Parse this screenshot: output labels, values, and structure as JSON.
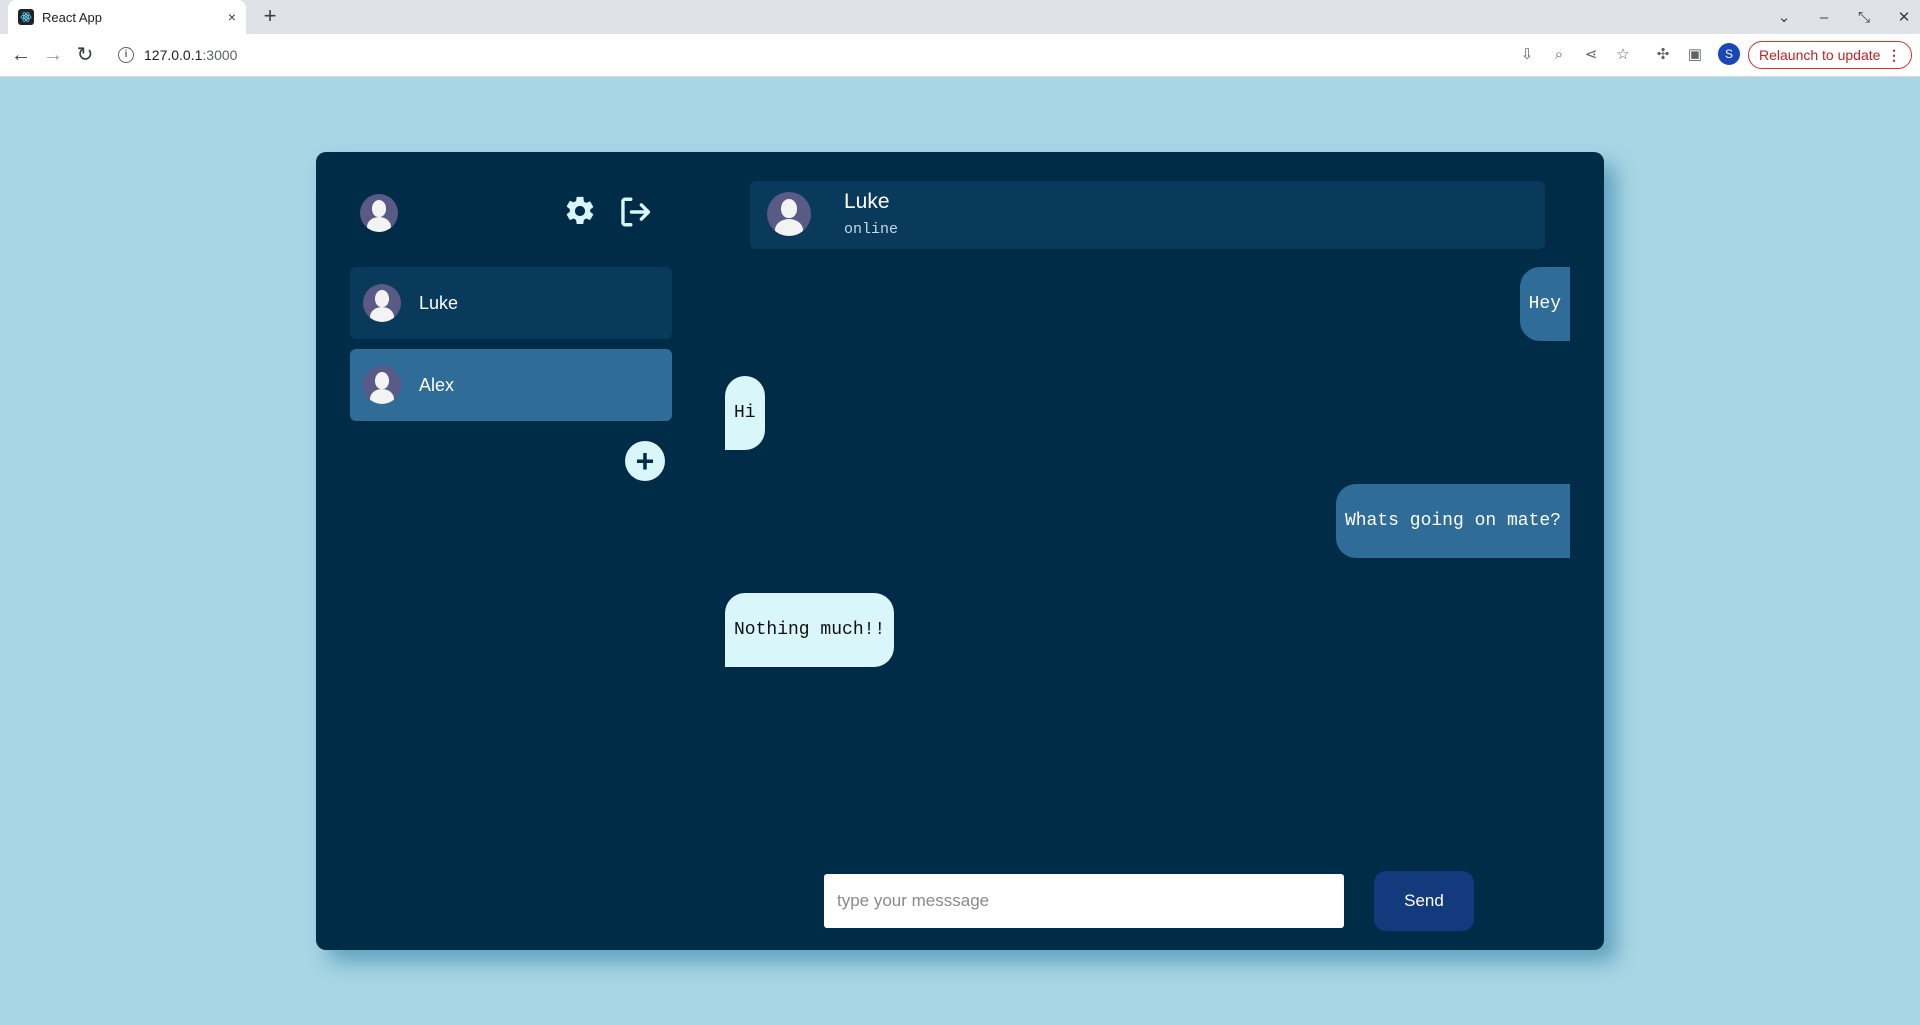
{
  "browser": {
    "tab_title": "React App",
    "tab_close": "×",
    "new_tab": "+",
    "url_host": "127.0.0.1",
    "url_port": ":3000",
    "profile_initial": "S",
    "relaunch_label": "Relaunch to update",
    "relaunch_menu": "⋮"
  },
  "sidebar": {
    "contacts": [
      {
        "name": "Luke"
      },
      {
        "name": "Alex"
      }
    ],
    "add_label": "+"
  },
  "chat": {
    "header": {
      "name": "Luke",
      "status": "online"
    },
    "messages": [
      {
        "text": "Hey",
        "direction": "sent"
      },
      {
        "text": "Hi",
        "direction": "received"
      },
      {
        "text": "Whats going on mate?",
        "direction": "sent"
      },
      {
        "text": "Nothing much!!",
        "direction": "received"
      }
    ]
  },
  "composer": {
    "placeholder": "type your messsage",
    "value": "",
    "send_label": "Send"
  },
  "colors": {
    "page_background": "#a8d6e5",
    "app_background": "#012c47",
    "contact_background": "#093a5c",
    "contact_active": "#2f6c98",
    "sent_bubble": "#2f6c98",
    "received_bubble": "#d9f6fb",
    "send_button": "#133a7c",
    "accent_icon": "#d9f6fb"
  }
}
